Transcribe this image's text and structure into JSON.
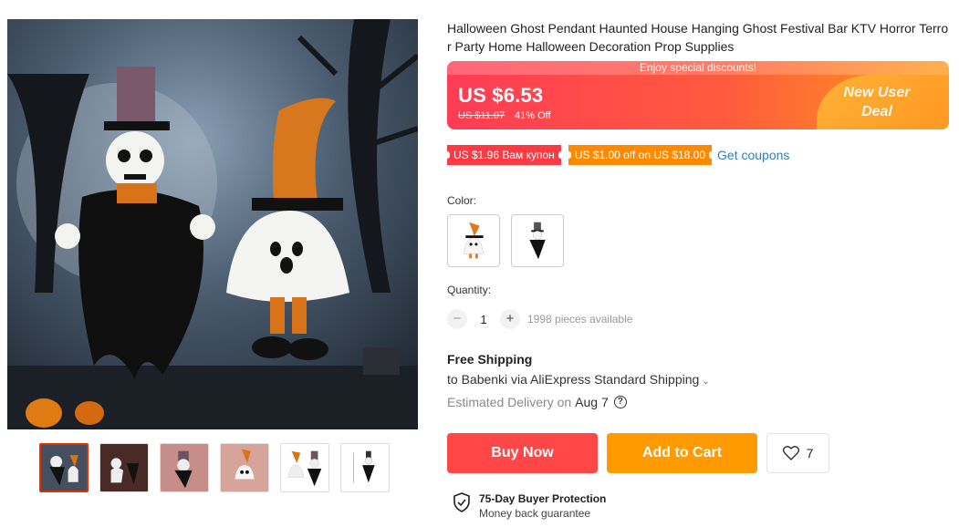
{
  "product": {
    "title": "Halloween Ghost Pendant Haunted House Hanging Ghost Festival Bar KTV Horror Terror Party Home Halloween Decoration Prop Supplies"
  },
  "gallery": {
    "main_image_icon": "halloween-ghosts-image",
    "thumbnails": [
      {
        "icon": "thumb-1",
        "active": true
      },
      {
        "icon": "thumb-2",
        "active": false
      },
      {
        "icon": "thumb-3",
        "active": false
      },
      {
        "icon": "thumb-4",
        "active": false
      },
      {
        "icon": "thumb-5",
        "active": false
      },
      {
        "icon": "thumb-6",
        "active": false
      }
    ]
  },
  "price_banner": {
    "strip_text": "Enjoy special discounts!",
    "price": "US $6.53",
    "old_price": "US $11.07",
    "discount": "41% Off",
    "deal_line1": "New User",
    "deal_line2": "Deal"
  },
  "coupons": {
    "coupon1": "US $1.96 Вам купон",
    "coupon2": "US $1.00 off on US $18.00",
    "get_coupons": "Get coupons"
  },
  "color": {
    "label": "Color:",
    "options": [
      "white-ghost-orange-hat",
      "black-ghost-top-hat"
    ]
  },
  "quantity": {
    "label": "Quantity:",
    "minus": "−",
    "value": "1",
    "plus": "+",
    "available": "1998 pieces available"
  },
  "shipping": {
    "title": "Free Shipping",
    "line": "to Babenki via AliExpress Standard Shipping",
    "chevron": "⌄",
    "delivery_label": "Estimated Delivery on",
    "delivery_date": "Aug 7",
    "help_icon": "?"
  },
  "actions": {
    "buy_now": "Buy Now",
    "add_to_cart": "Add to Cart",
    "wishlist_count": "7"
  },
  "protection": {
    "title": "75-Day Buyer Protection",
    "subtitle": "Money back guarantee"
  },
  "colors": {
    "accent_red": "#ff4747",
    "accent_orange": "#ff9a00",
    "link_blue": "#2e7fb8"
  }
}
